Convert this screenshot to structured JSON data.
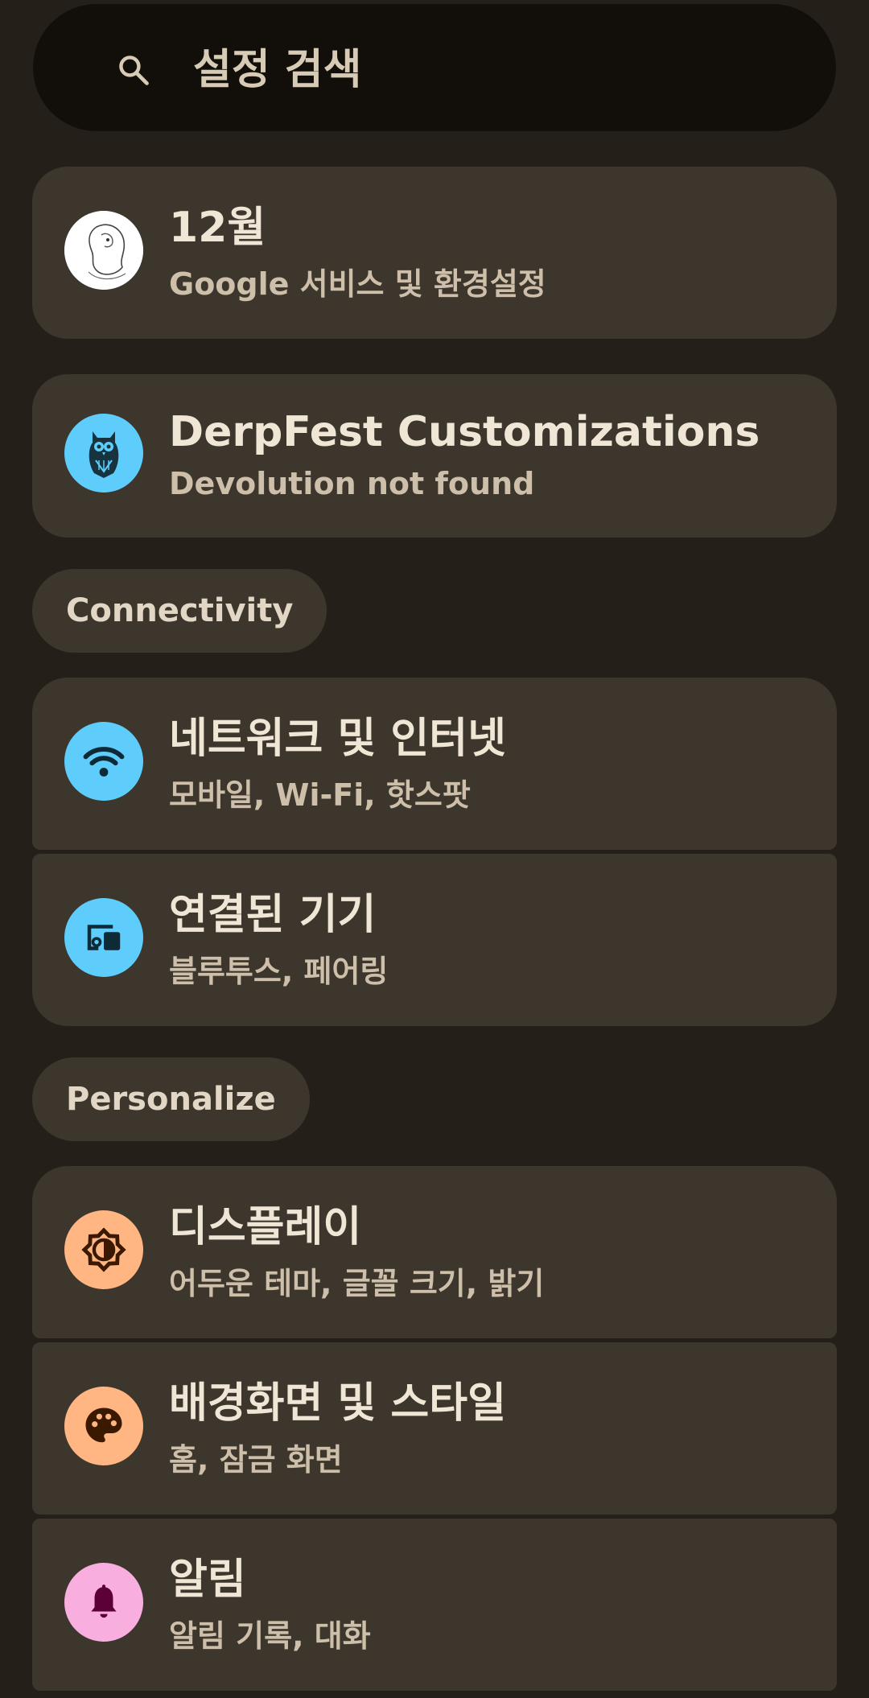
{
  "search": {
    "placeholder": "설정 검색",
    "icon": "search-icon"
  },
  "account": {
    "title": "12월",
    "subtitle": "Google 서비스 및 환경설정",
    "icon": "avatar"
  },
  "derpfest": {
    "title": "DerpFest Customizations",
    "subtitle": "Devolution not found",
    "icon": "owl-icon",
    "icon_bg": "#5fcdfc"
  },
  "sections": [
    {
      "header": "Connectivity",
      "items": [
        {
          "title": "네트워크 및 인터넷",
          "subtitle": "모바일, Wi-Fi, 핫스팟",
          "icon": "wifi-icon",
          "icon_bg": "#5fcdfc"
        },
        {
          "title": "연결된 기기",
          "subtitle": "블루투스, 페어링",
          "icon": "devices-icon",
          "icon_bg": "#5fcdfc"
        }
      ]
    },
    {
      "header": "Personalize",
      "items": [
        {
          "title": "디스플레이",
          "subtitle": "어두운 테마, 글꼴 크기, 밝기",
          "icon": "brightness-icon",
          "icon_bg": "#ffb683"
        },
        {
          "title": "배경화면 및 스타일",
          "subtitle": "홈, 잠금 화면",
          "icon": "palette-icon",
          "icon_bg": "#ffb683"
        },
        {
          "title": "알림",
          "subtitle": "알림 기록, 대화",
          "icon": "bell-icon",
          "icon_bg": "#f9aee0"
        }
      ]
    }
  ],
  "colors": {
    "background": "#242019",
    "card": "#3d362d",
    "search_bg": "#120f0a",
    "title_text": "#efe6d6",
    "subtitle_text": "#cdbfa9"
  }
}
